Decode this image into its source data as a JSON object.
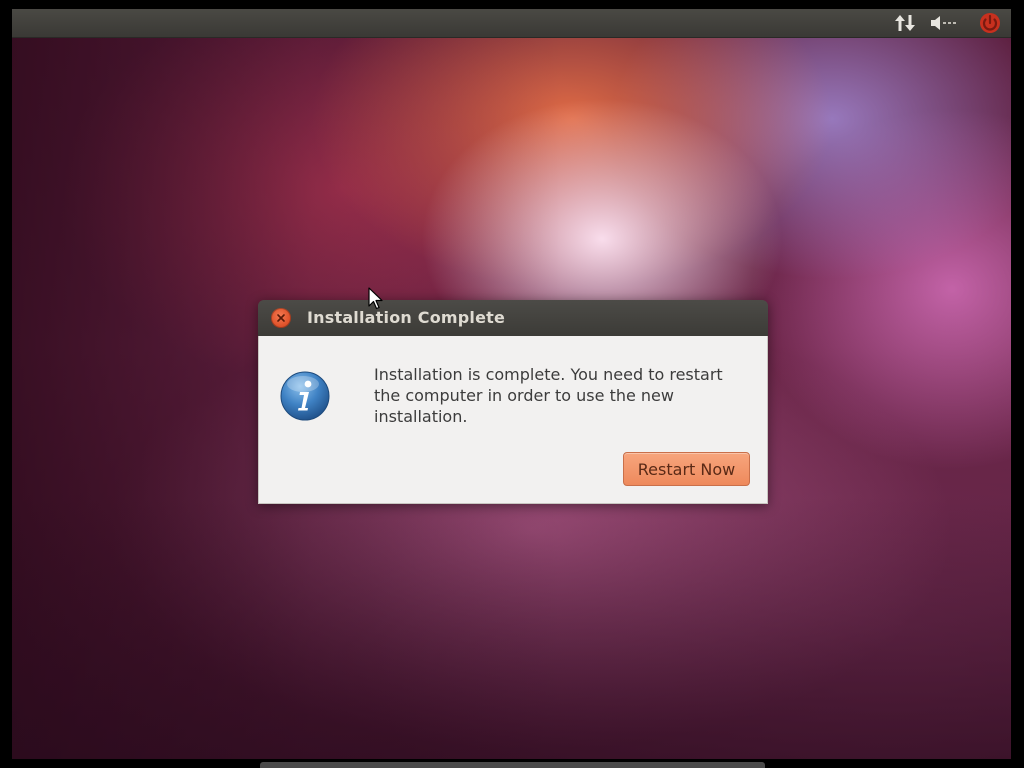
{
  "panel": {
    "icons": [
      "network-arrows-icon",
      "volume-muted-icon",
      "power-icon"
    ]
  },
  "dialog": {
    "title": "Installation Complete",
    "message": "Installation is complete. You need to restart the computer in order to use the new installation.",
    "icon": "info-icon",
    "restart_label": "Restart Now"
  },
  "colors": {
    "panel_bg": "#3c3b37",
    "accent": "#ee8a5c",
    "close_button": "#e0532b",
    "dialog_bg": "#f2f1f0"
  }
}
